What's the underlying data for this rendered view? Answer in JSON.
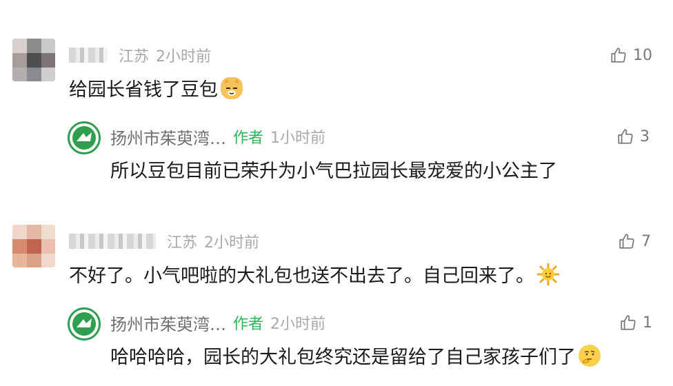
{
  "comments": [
    {
      "location": "江苏",
      "time": "2小时前",
      "likes": "10",
      "text": "给园长省钱了豆包",
      "emoji": "smirk-cat-emoji",
      "reply": {
        "name": "扬州市茱萸湾…",
        "author_tag": "作者",
        "time": "1小时前",
        "likes": "3",
        "text": "所以豆包目前已荣升为小气巴拉园长最宠爱的小公主了"
      }
    },
    {
      "location": "江苏",
      "time": "2小时前",
      "likes": "7",
      "text": "不好了。小气吧啦的大礼包也送不出去了。自己回来了。",
      "emoji": "sun-emoji",
      "reply": {
        "name": "扬州市茱萸湾…",
        "author_tag": "作者",
        "time": "2小时前",
        "likes": "1",
        "text": "哈哈哈哈，园长的大礼包终究还是留给了自己家孩子们了",
        "emoji": "thinking-emoji"
      }
    }
  ],
  "colors": {
    "author_green": "#2fb35b",
    "meta_gray": "#a8a8a8",
    "text_dark": "#1a1a1a"
  },
  "icons": {
    "like": "thumbs-up-outline-icon"
  }
}
